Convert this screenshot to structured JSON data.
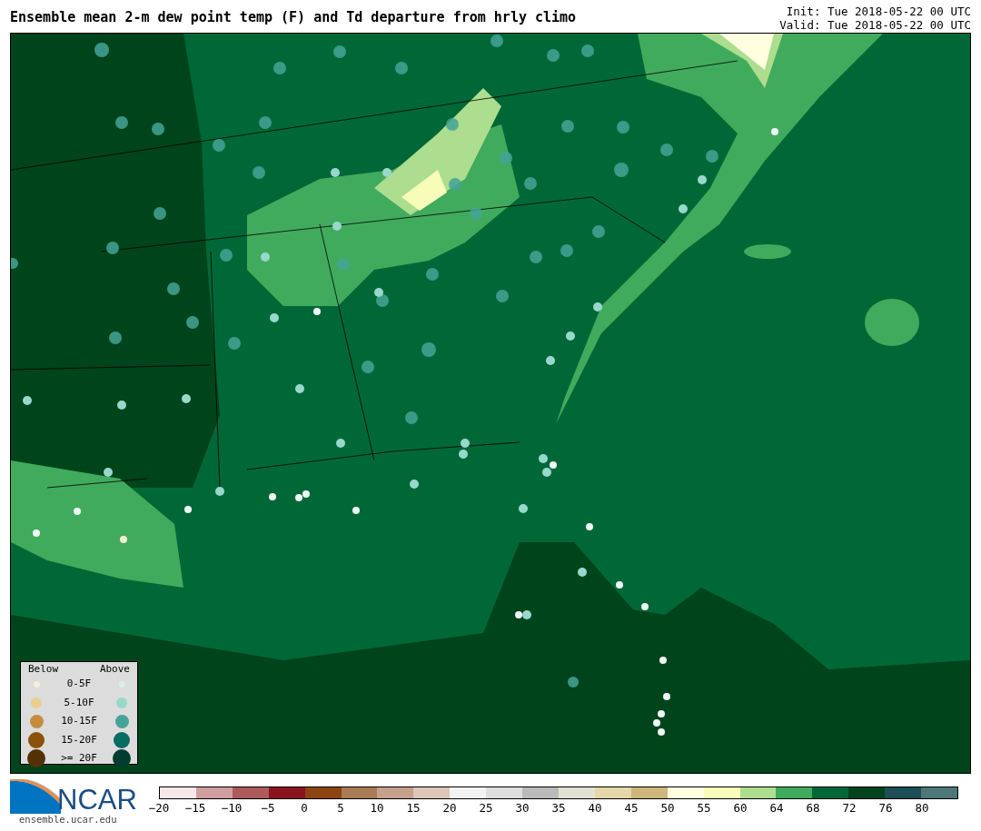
{
  "title": "Ensemble mean 2-m dew point temp (F) and Td departure from hrly climo",
  "init": "Init: Tue 2018-05-22 00 UTC",
  "valid": "Valid: Tue 2018-05-22 00 UTC",
  "legend": {
    "below_heading": "Below",
    "above_heading": "Above",
    "rows": [
      {
        "label": "0-5F",
        "below": {
          "color": "#f7eed6"
        },
        "above": {
          "color": "#d6f0ec"
        }
      },
      {
        "label": "5-10F",
        "below": {
          "color": "#e8cf8e"
        },
        "above": {
          "color": "#98d8cc"
        }
      },
      {
        "label": "10-15F",
        "below": {
          "color": "#c68c3e"
        },
        "above": {
          "color": "#45a497"
        }
      },
      {
        "label": "15-20F",
        "below": {
          "color": "#8c510a"
        },
        "above": {
          "color": "#076c62"
        }
      },
      {
        "label": ">= 20F",
        "below": {
          "color": "#543005"
        },
        "above": {
          "color": "#003c30"
        }
      }
    ]
  },
  "logo": {
    "text": "NCAR",
    "url": "ensemble.ucar.edu"
  },
  "colorbar": {
    "segments": [
      {
        "color": "#f7e9ea"
      },
      {
        "color": "#d19ea0"
      },
      {
        "color": "#ad5a5c"
      },
      {
        "color": "#8a141e"
      },
      {
        "color": "#8c4410"
      },
      {
        "color": "#a97b55"
      },
      {
        "color": "#c5a08a"
      },
      {
        "color": "#dfc6b6"
      },
      {
        "color": "#f2f2f2"
      },
      {
        "color": "#dedede"
      },
      {
        "color": "#bababa"
      },
      {
        "color": "#e2e2d2"
      },
      {
        "color": "#e6d7a8"
      },
      {
        "color": "#cdb77a"
      },
      {
        "color": "#ffffe0"
      },
      {
        "color": "#f7fcb9"
      },
      {
        "color": "#addd8e"
      },
      {
        "color": "#41ab5d"
      },
      {
        "color": "#006837"
      },
      {
        "color": "#00441b"
      },
      {
        "color": "#1b4f55"
      },
      {
        "color": "#4d7779"
      }
    ],
    "ticks": [
      "−20",
      "−15",
      "−10",
      "−5",
      "0",
      "5",
      "10",
      "15",
      "20",
      "25",
      "30",
      "35",
      "40",
      "45",
      "50",
      "55",
      "60",
      "64",
      "68",
      "72",
      "76",
      "80"
    ]
  }
}
